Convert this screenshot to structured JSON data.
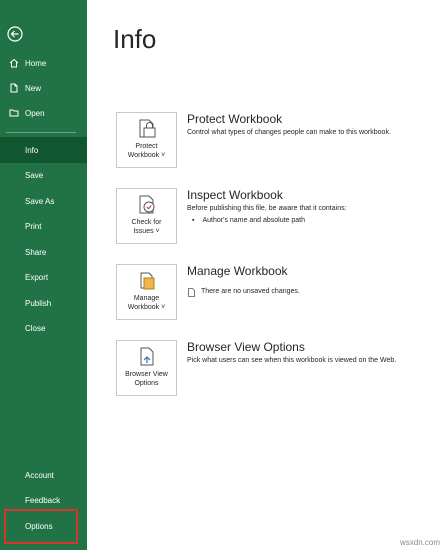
{
  "sidebar": {
    "top_items": [
      {
        "label": "Home"
      },
      {
        "label": "New"
      },
      {
        "label": "Open"
      }
    ],
    "items": [
      {
        "label": "Info"
      },
      {
        "label": "Save"
      },
      {
        "label": "Save As"
      },
      {
        "label": "Print"
      },
      {
        "label": "Share"
      },
      {
        "label": "Export"
      },
      {
        "label": "Publish"
      },
      {
        "label": "Close"
      }
    ],
    "bottom_items": [
      {
        "label": "Account"
      },
      {
        "label": "Feedback"
      },
      {
        "label": "Options"
      }
    ],
    "active": "Info",
    "highlighted": "Options"
  },
  "main": {
    "title": "Info",
    "cards": [
      {
        "button_line1": "Protect",
        "button_line2": "Workbook ˅",
        "title": "Protect Workbook",
        "description": "Control what types of changes people can make to this workbook."
      },
      {
        "button_line1": "Check for",
        "button_line2": "Issues ˅",
        "title": "Inspect Workbook",
        "description": "Before publishing this file, be aware that it contains:",
        "bullet": "Author's name and absolute path"
      },
      {
        "button_line1": "Manage",
        "button_line2": "Workbook ˅",
        "title": "Manage Workbook",
        "description": "There are no unsaved changes."
      },
      {
        "button_line1": "Browser View",
        "button_line2": "Options",
        "title": "Browser View Options",
        "description": "Pick what users can see when this workbook is viewed on the Web."
      }
    ]
  },
  "watermark": "wsxdn.com",
  "colors": {
    "sidebar_bg": "#217346",
    "active_bg": "#10572f",
    "highlight_border": "#d9332e"
  }
}
